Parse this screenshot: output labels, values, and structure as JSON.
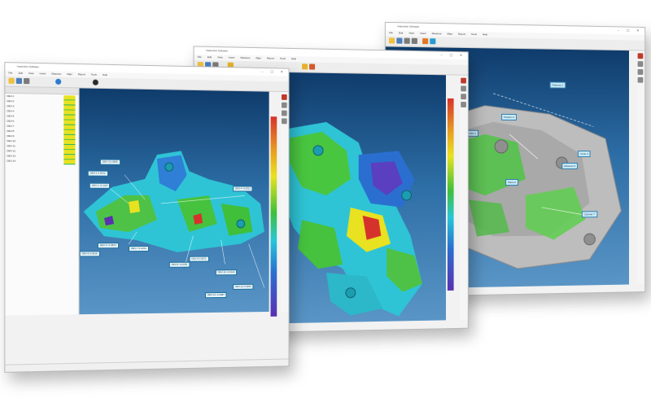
{
  "screens": {
    "left": {
      "title": "Inspection Software",
      "menu": [
        "File",
        "Edit",
        "View",
        "Insert",
        "Measure",
        "Align",
        "Report",
        "Tools",
        "Help"
      ],
      "table_rows": [
        "DEV-1",
        "DEV-2",
        "DEV-3",
        "DEV-4",
        "DEV-5",
        "DEV-6",
        "DEV-7",
        "DEV-8",
        "DEV-9",
        "DEV-10",
        "DEV-11",
        "DEV-12",
        "DEV-13",
        "DEV-14"
      ],
      "dev_labels": [
        "DEV-1 0.0412",
        "DEV-2 -0.1120",
        "DEV-3 0.0905",
        "DEV-4 -0.0311",
        "DEV-5 0.0518",
        "DEV-6 -0.0823",
        "DEV-7 0.1204",
        "DEV-8 -0.0250",
        "DEV-9 0.0671",
        "DEV-10 -0.0144",
        "DEV-11 0.0390",
        "DEV-12 -0.0987"
      ]
    },
    "middle": {
      "title": "Inspection Software",
      "menu": [
        "File",
        "Edit",
        "View",
        "Insert",
        "Measure",
        "Align",
        "Report",
        "Tools",
        "Help"
      ]
    },
    "right": {
      "title": "Inspection Software",
      "menu": [
        "File",
        "Edit",
        "View",
        "Insert",
        "Measure",
        "Align",
        "Report",
        "Tools",
        "Help"
      ],
      "callouts": [
        "Flatness 1",
        "Position 2",
        "Profile 3",
        "Circle 4",
        "Distance 5",
        "Plane 6",
        "Cylinder 7"
      ]
    }
  },
  "colors": {
    "viewport_top": "#0f3c6c",
    "viewport_bottom": "#5a95c6",
    "deviation_green": "#3fbf3a",
    "deviation_cyan": "#27c6d8",
    "deviation_yellow": "#e8e221",
    "deviation_red": "#d6322c",
    "deviation_blue": "#2243c6",
    "part_gray": "#b8b8b8"
  }
}
